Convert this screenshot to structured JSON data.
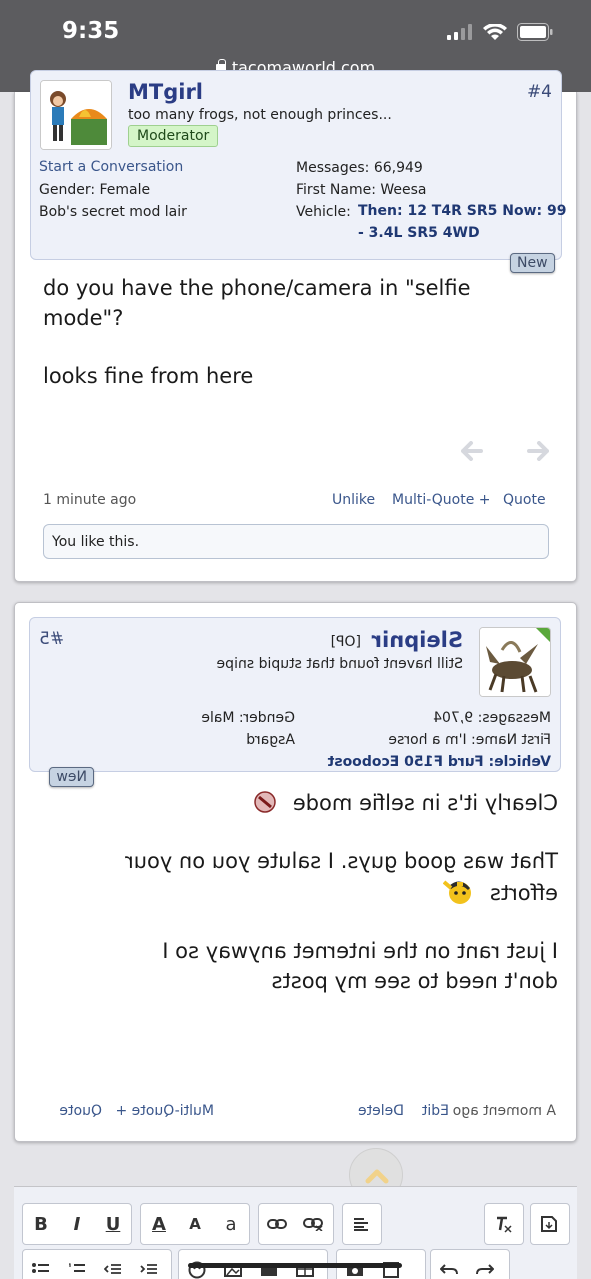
{
  "status_bar": {
    "time": "9:35",
    "url": "tacomaworld.com"
  },
  "post4": {
    "number": "#4",
    "username": "MTgirl",
    "user_title": "too many frogs, not enough princes...",
    "badge": "Moderator",
    "start_conversation": "Start a Conversation",
    "gender": "Gender:  Female",
    "location": "Bob's secret mod lair",
    "messages": "Messages:  66,949",
    "first_name": "First Name:  Weesa",
    "vehicle_label": "Vehicle:",
    "vehicle_line1": "Then: 12 T4R SR5 Now: 99",
    "vehicle_line2": "- 3.4L SR5 4WD",
    "new_label": "New",
    "message_lines": [
      "do you have the phone/camera in \"selfie",
      "mode\"?",
      "",
      "looks fine from here"
    ],
    "time": "1 minute ago",
    "actions": {
      "unlike": "Unlike",
      "multi_quote": "Multi-Quote +",
      "quote": "Quote"
    },
    "likes": "You like this."
  },
  "post5": {
    "number": "#5",
    "username": "Sleipnir",
    "op_tag": "[OP]",
    "user_title": "Still havent found that stupid snipe",
    "messages": "Messages:  9,704",
    "first_name": "First Name:  I'm a horse",
    "vehicle": "Vehicle:  Furd F150 Ecoboost",
    "gender": "Gender:  Male",
    "location": "Asgard",
    "new_label": "New",
    "message_lines": [
      "Clearly it's in selfie mode",
      "",
      "That was good guys. I salute you on your",
      "efforts",
      "",
      "I just rant on the internet anyway so I",
      "don't need to see my posts"
    ],
    "time": "A moment ago",
    "actions": {
      "edit": "Edit",
      "delete": "Delete",
      "multi_quote": "Multi-Quote +",
      "quote": "Quote"
    }
  },
  "editor": {
    "bold": "B",
    "italic": "I",
    "underline": "U",
    "font_color": "A",
    "font_size": "A",
    "font_family": "a"
  },
  "colors": {
    "link": "#3a568b",
    "username": "#2b3d85",
    "status_bar": "#5c5c5f"
  }
}
